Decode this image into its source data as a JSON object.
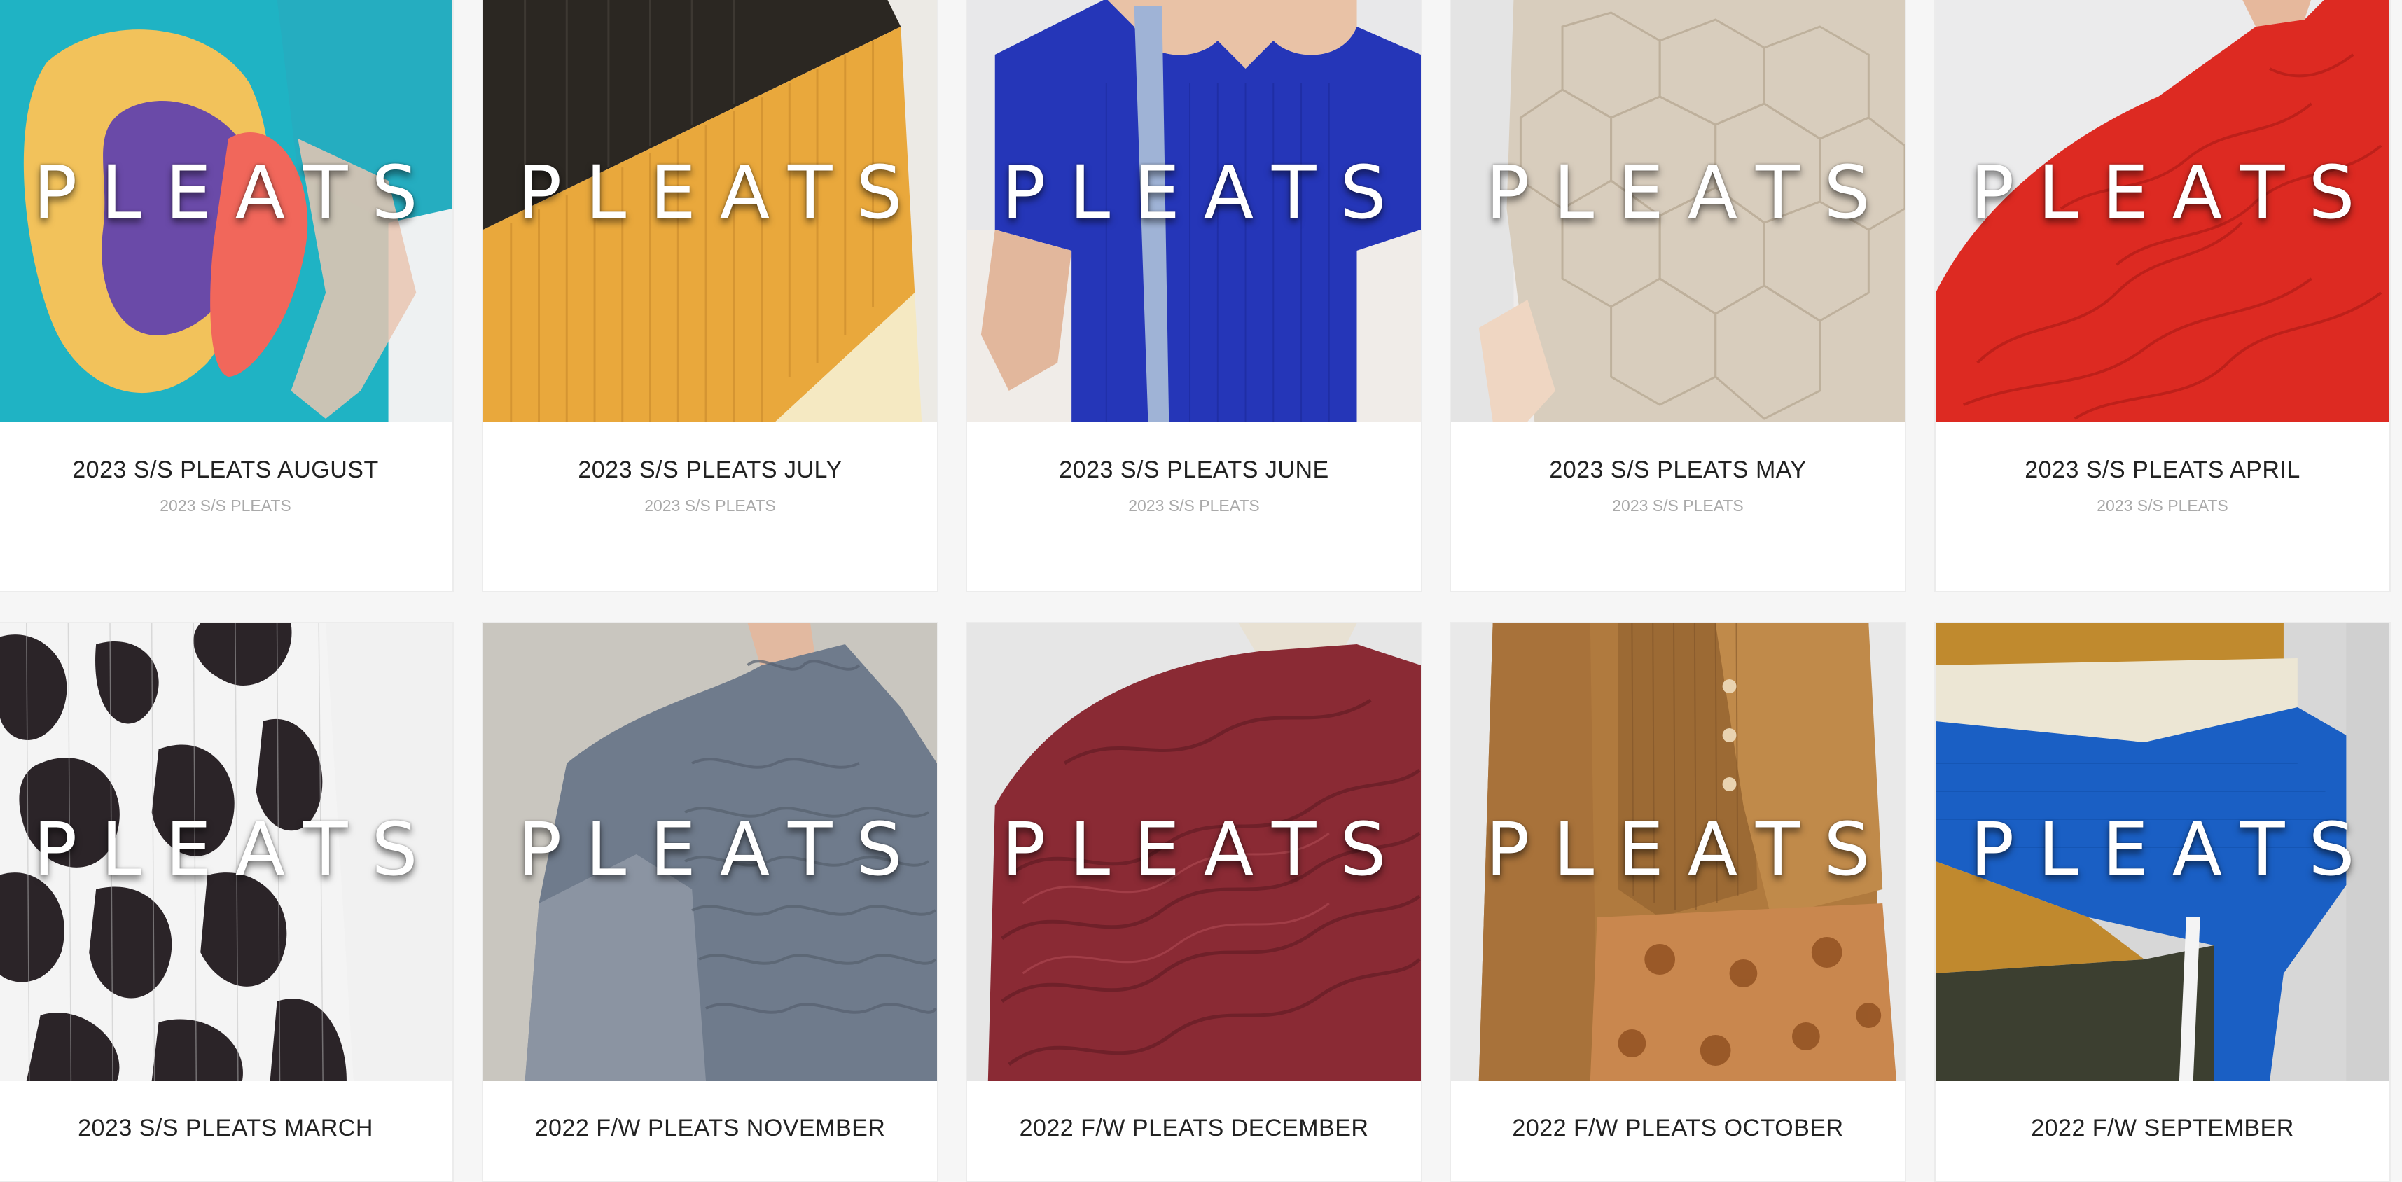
{
  "collection_cards": [
    {
      "brand": "PLEATS",
      "title": "2023 S/S PLEATS AUGUST",
      "category": "2023 S/S PLEATS",
      "image": "teal-yellow-purple-abstract"
    },
    {
      "brand": "PLEATS",
      "title": "2023 S/S PLEATS JULY",
      "category": "2023 S/S PLEATS",
      "image": "black-orange-cream-diagonal"
    },
    {
      "brand": "PLEATS",
      "title": "2023 S/S PLEATS JUNE",
      "category": "2023 S/S PLEATS",
      "image": "cobalt-blue-top"
    },
    {
      "brand": "PLEATS",
      "title": "2023 S/S PLEATS MAY",
      "category": "2023 S/S PLEATS",
      "image": "beige-geometric-texture"
    },
    {
      "brand": "PLEATS",
      "title": "2023 S/S PLEATS APRIL",
      "category": "2023 S/S PLEATS",
      "image": "red-textured-top"
    },
    {
      "brand": "PLEATS",
      "title": "2023 S/S PLEATS MARCH",
      "category": "",
      "image": "black-white-floral-skirt"
    },
    {
      "brand": "PLEATS",
      "title": "2022 F/W PLEATS NOVEMBER",
      "category": "",
      "image": "grey-blue-smocked-top"
    },
    {
      "brand": "PLEATS",
      "title": "2022 F/W PLEATS DECEMBER",
      "category": "",
      "image": "burgundy-crinkle-top"
    },
    {
      "brand": "PLEATS",
      "title": "2022 F/W PLEATS OCTOBER",
      "category": "",
      "image": "ochre-cardigan-floral-skirt"
    },
    {
      "brand": "PLEATS",
      "title": "2022 F/W SEPTEMBER",
      "category": "",
      "image": "colorblock-knit-top"
    }
  ]
}
